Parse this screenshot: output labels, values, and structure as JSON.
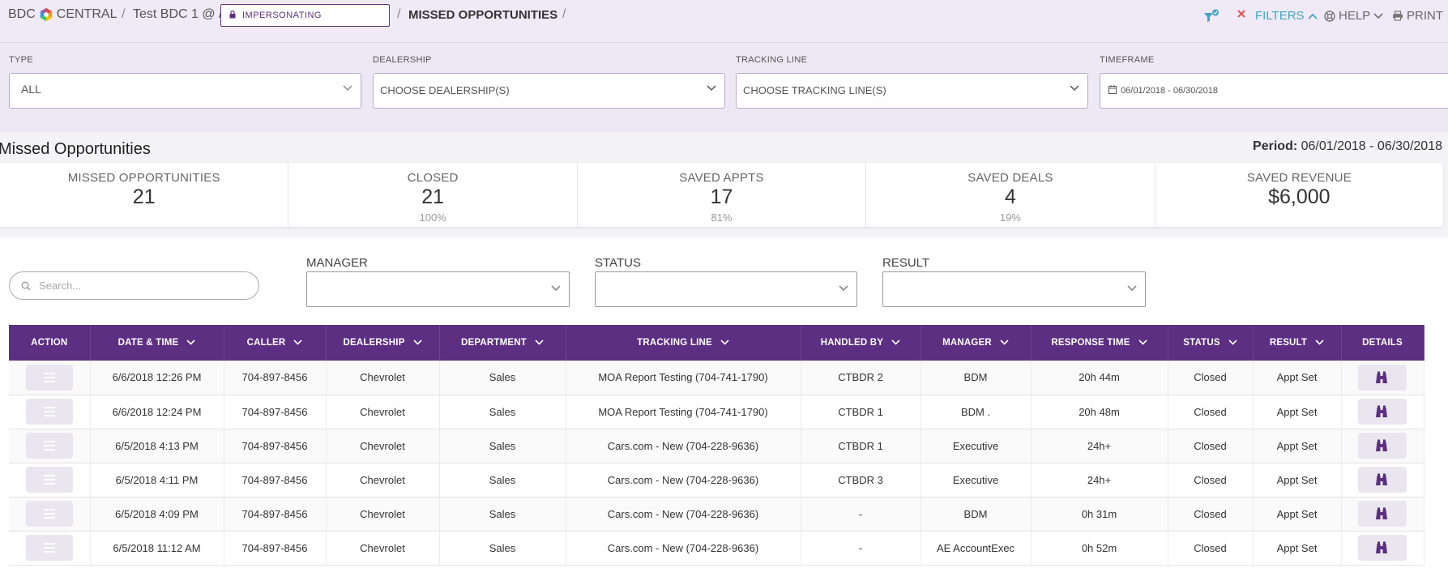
{
  "breadcrumb": {
    "brand_left": "BDC",
    "brand_right": "CENTRAL",
    "account": "Test BDC 1 @ /",
    "impersonating": "IMPERSONATING",
    "page": "MISSED OPPORTUNITIES",
    "trailing_sep": "/"
  },
  "toolbar": {
    "filters_label": "FILTERS",
    "help_label": "HELP",
    "print_label": "PRINT"
  },
  "filters": {
    "type": {
      "label": "TYPE",
      "value": "ALL"
    },
    "dealership": {
      "label": "DEALERSHIP",
      "value": "CHOOSE DEALERSHIP(S)"
    },
    "tracking_line": {
      "label": "TRACKING LINE",
      "value": "CHOOSE TRACKING LINE(S)"
    },
    "timeframe": {
      "label": "TIMEFRAME",
      "value": "06/01/2018 - 06/30/2018"
    }
  },
  "summary": {
    "title": "Missed Opportunities",
    "period_label": "Period:",
    "period_value": "06/01/2018 - 06/30/2018",
    "stats": [
      {
        "label": "MISSED OPPORTUNITIES",
        "value": "21",
        "pct": ""
      },
      {
        "label": "CLOSED",
        "value": "21",
        "pct": "100%"
      },
      {
        "label": "SAVED APPTS",
        "value": "17",
        "pct": "81%"
      },
      {
        "label": "SAVED DEALS",
        "value": "4",
        "pct": "19%"
      },
      {
        "label": "SAVED REVENUE",
        "value": "$6,000",
        "pct": ""
      }
    ]
  },
  "list_filters": {
    "search_placeholder": "Search...",
    "manager_label": "MANAGER",
    "status_label": "STATUS",
    "result_label": "RESULT"
  },
  "table": {
    "headers": [
      "ACTION",
      "DATE & TIME",
      "CALLER",
      "DEALERSHIP",
      "DEPARTMENT",
      "TRACKING LINE",
      "HANDLED BY",
      "MANAGER",
      "RESPONSE TIME",
      "STATUS",
      "RESULT",
      "DETAILS"
    ],
    "rows": [
      {
        "date": "6/6/2018  12:26 PM",
        "caller": "704-897-8456",
        "dealership": "Chevrolet",
        "department": "Sales",
        "tracking_line": "MOA Report Testing (704-741-1790)",
        "handled_by": "CTBDR 2",
        "manager": "BDM",
        "response_time": "20h 44m",
        "status": "Closed",
        "result": "Appt Set"
      },
      {
        "date": "6/6/2018  12:24 PM",
        "caller": "704-897-8456",
        "dealership": "Chevrolet",
        "department": "Sales",
        "tracking_line": "MOA Report Testing (704-741-1790)",
        "handled_by": "CTBDR 1",
        "manager": "BDM .",
        "response_time": "20h 48m",
        "status": "Closed",
        "result": "Appt Set"
      },
      {
        "date": "6/5/2018  4:13 PM",
        "caller": "704-897-8456",
        "dealership": "Chevrolet",
        "department": "Sales",
        "tracking_line": "Cars.com - New (704-228-9636)",
        "handled_by": "CTBDR 1",
        "manager": "Executive",
        "response_time": "24h+",
        "status": "Closed",
        "result": "Appt Set"
      },
      {
        "date": "6/5/2018  4:11 PM",
        "caller": "704-897-8456",
        "dealership": "Chevrolet",
        "department": "Sales",
        "tracking_line": "Cars.com - New (704-228-9636)",
        "handled_by": "CTBDR 3",
        "manager": "Executive",
        "response_time": "24h+",
        "status": "Closed",
        "result": "Appt Set"
      },
      {
        "date": "6/5/2018  4:09 PM",
        "caller": "704-897-8456",
        "dealership": "Chevrolet",
        "department": "Sales",
        "tracking_line": "Cars.com - New (704-228-9636)",
        "handled_by": "-",
        "manager": "BDM",
        "response_time": "0h 31m",
        "status": "Closed",
        "result": "Appt Set"
      },
      {
        "date": "6/5/2018  11:12 AM",
        "caller": "704-897-8456",
        "dealership": "Chevrolet",
        "department": "Sales",
        "tracking_line": "Cars.com - New (704-228-9636)",
        "handled_by": "-",
        "manager": "AE AccountExec",
        "response_time": "0h 52m",
        "status": "Closed",
        "result": "Appt Set"
      }
    ]
  },
  "colors": {
    "brand_purple": "#5c2f82",
    "accent_teal": "#46a4c8",
    "close_red": "#e05555"
  }
}
